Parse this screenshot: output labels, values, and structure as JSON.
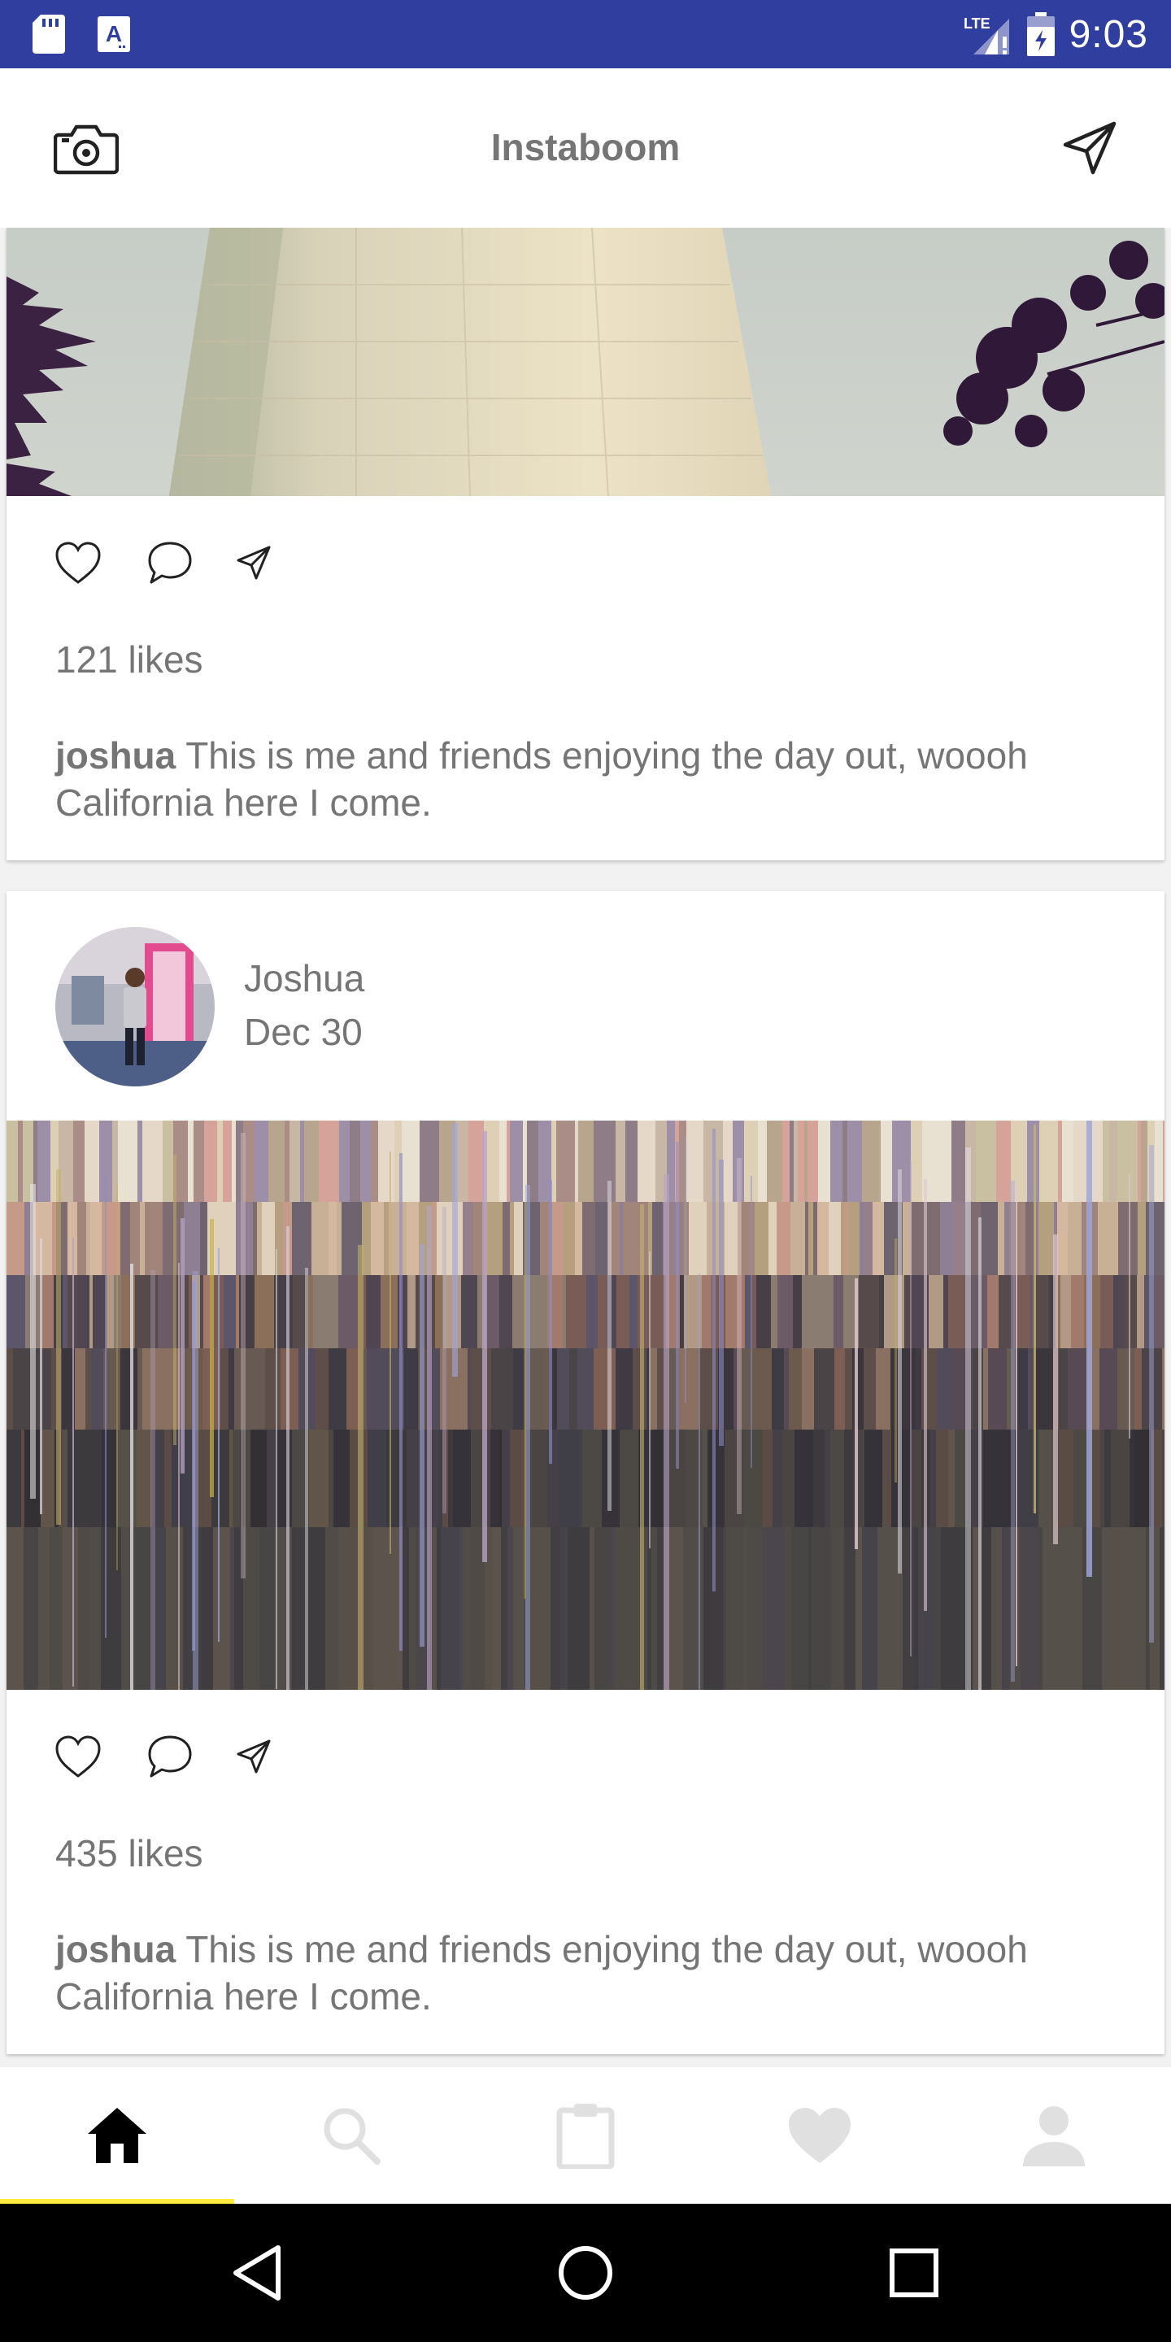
{
  "status_bar": {
    "time": "9:03",
    "network": "LTE",
    "background": "#303f9f",
    "icons": [
      "sd-card-icon",
      "text-a-icon",
      "lte-signal-icon",
      "battery-icon"
    ]
  },
  "app_bar": {
    "title": "Instaboom",
    "left_icon": "camera-icon",
    "right_icon": "send-icon"
  },
  "posts": [
    {
      "likes": "121 likes",
      "caption_user": "joshua",
      "caption_text": " This is me and friends enjoying the day out, woooh California here I come.",
      "actions": [
        "heart-icon",
        "comment-icon",
        "share-icon"
      ]
    },
    {
      "author": "Joshua",
      "date": "Dec 30",
      "likes": "435 likes",
      "caption_user": "joshua",
      "caption_text": " This is me and friends enjoying the day out, woooh California here I come.",
      "actions": [
        "heart-icon",
        "comment-icon",
        "share-icon"
      ]
    }
  ],
  "bottom_nav": {
    "items": [
      "home-icon",
      "search-icon",
      "clipboard-icon",
      "heart-icon",
      "profile-icon"
    ],
    "active_index": 0,
    "active_color": "#000000",
    "inactive_color": "#e0e0e0",
    "indicator_color": "#ffeb3b"
  },
  "system_nav": {
    "items": [
      "back-icon",
      "home-circle-icon",
      "recents-icon"
    ]
  }
}
